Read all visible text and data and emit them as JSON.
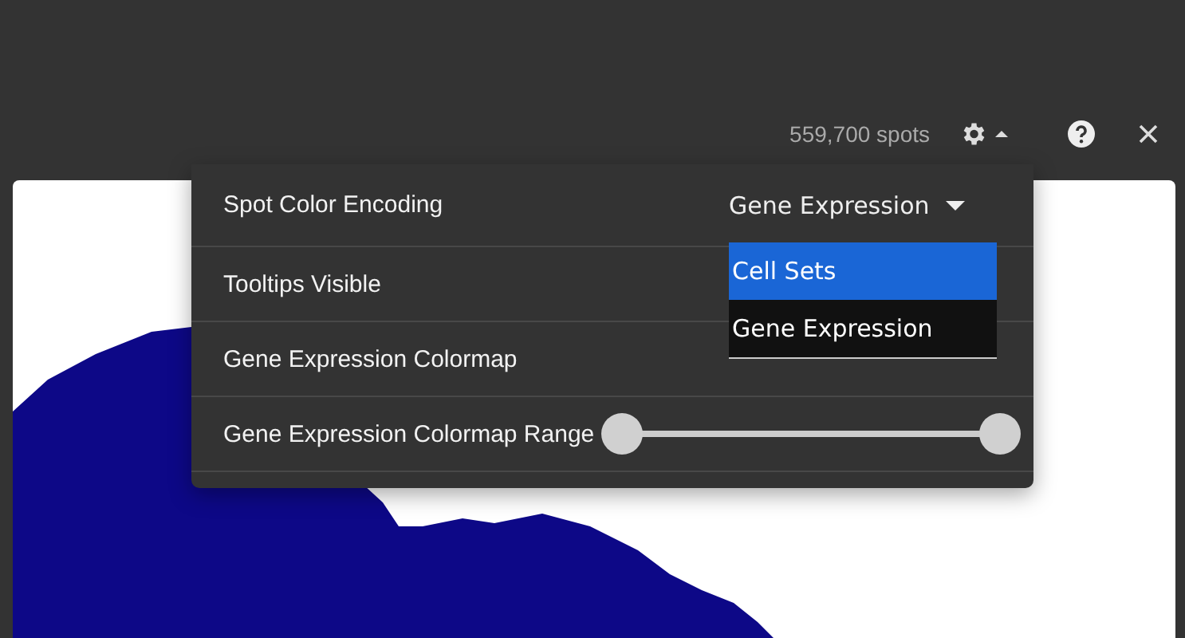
{
  "header": {
    "spot_count": "559,700 spots",
    "settings_open": true
  },
  "settings": {
    "rows": [
      {
        "kind": "select",
        "label": "Spot Color Encoding",
        "value": "Gene Expression",
        "open": true,
        "options": [
          {
            "label": "Cell Sets",
            "highlighted": true
          },
          {
            "label": "Gene Expression",
            "highlighted": false
          }
        ]
      },
      {
        "kind": "checkbox",
        "label": "Tooltips Visible"
      },
      {
        "kind": "select",
        "label": "Gene Expression Colormap"
      },
      {
        "kind": "range",
        "label": "Gene Expression Colormap Range",
        "thumbs": [
          {
            "level": 0
          },
          {
            "level": 1
          }
        ]
      }
    ]
  }
}
